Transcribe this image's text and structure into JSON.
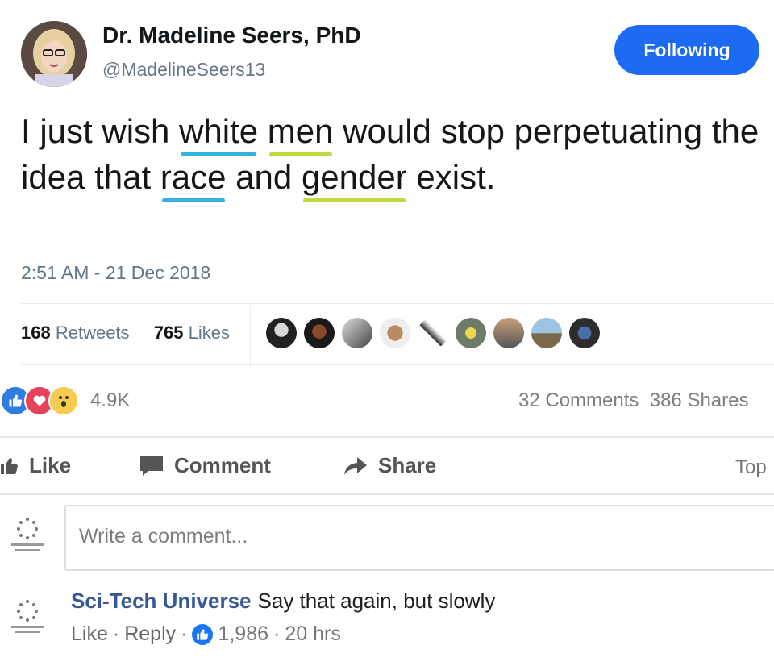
{
  "tweet": {
    "author_name": "Dr. Madeline Seers, PhD",
    "author_handle": "@MadelineSeers13",
    "follow_label": "Following",
    "text_parts": [
      "I just wish ",
      "white",
      " ",
      "men",
      " would stop perpetuating the idea that ",
      "race",
      " and ",
      "gender",
      " exist."
    ],
    "timestamp": "2:51 AM - 21 Dec 2018",
    "retweets_count": "168",
    "retweets_label": "Retweets",
    "likes_count": "765",
    "likes_label": "Likes",
    "colors": {
      "follow_button": "#1d6bf2",
      "underline_blue": "#34b4dc",
      "underline_yellow": "#c3d83e"
    }
  },
  "facebook": {
    "reactions": [
      "like-icon",
      "love-icon",
      "wow-icon"
    ],
    "reaction_count": "4.9K",
    "comments_count": "32 Comments",
    "shares_count": "386 Shares",
    "actions": {
      "like": "Like",
      "comment": "Comment",
      "share": "Share",
      "top": "Top"
    },
    "comment_input_placeholder": "Write a comment...",
    "comment": {
      "author": "Sci-Tech Universe",
      "text": "Say that again, but slowly",
      "like_label": "Like",
      "reply_label": "Reply",
      "likes": "1,986",
      "age": "20 hrs"
    }
  }
}
